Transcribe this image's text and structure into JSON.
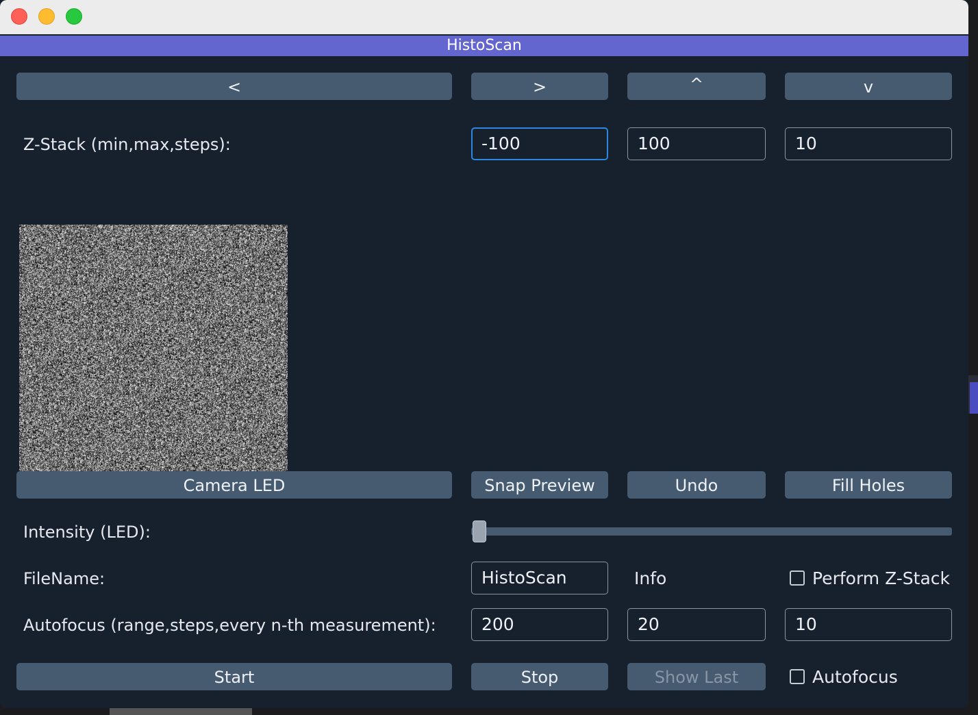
{
  "window": {
    "title": "HistoScan"
  },
  "navigation": {
    "left_label": "<",
    "right_label": ">",
    "up_label": "^",
    "down_label": "v"
  },
  "zstack": {
    "label": "Z-Stack (min,max,steps):",
    "min": "-100",
    "max": "100",
    "steps": "10"
  },
  "preview": {
    "icon": "camera-preview-noise"
  },
  "actions": {
    "camera_led": "Camera LED",
    "snap_preview": "Snap Preview",
    "undo": "Undo",
    "fill_holes": "Fill Holes"
  },
  "intensity": {
    "label": "Intensity (LED):",
    "value_fraction": 0.0
  },
  "file": {
    "label": "FileName:",
    "value": "HistoScan",
    "info": "Info",
    "perform_zstack_label": "Perform Z-Stack",
    "perform_zstack_checked": false
  },
  "autofocus": {
    "label": "Autofocus (range,steps,every n-th measurement):",
    "range": "200",
    "steps": "20",
    "every_nth": "10",
    "checkbox_label": "Autofocus",
    "checked": false
  },
  "controls": {
    "start": "Start",
    "stop": "Stop",
    "show_last": "Show Last"
  },
  "colors": {
    "background": "#17212e",
    "button": "#465a70",
    "app_bar": "#6466cf",
    "focus_border": "#2b87e0"
  }
}
